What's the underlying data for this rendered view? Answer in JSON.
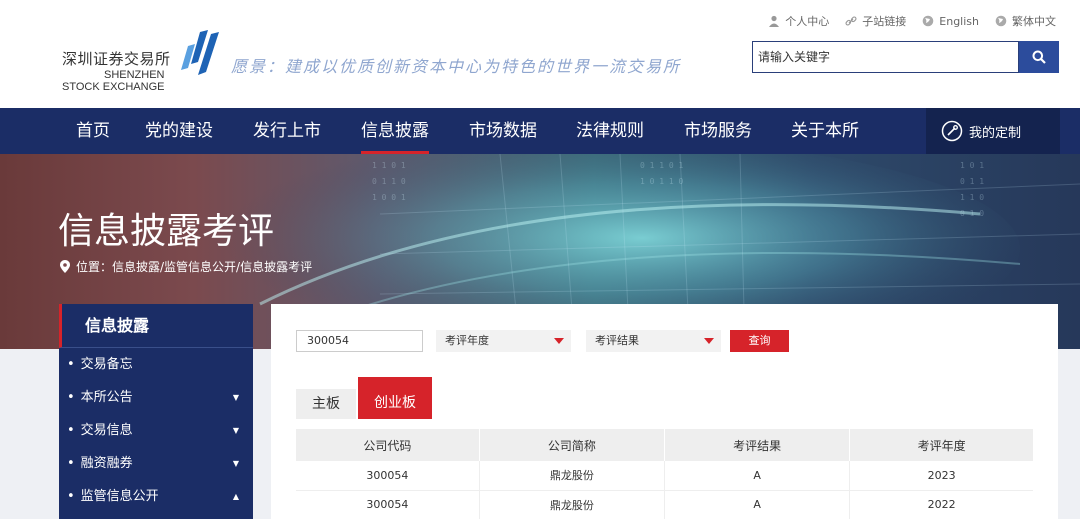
{
  "header": {
    "logo": {
      "cn": "深圳证券交易所",
      "en_line1": "SHENZHEN",
      "en_line2": "STOCK EXCHANGE"
    },
    "slogan": "愿景：建成以优质创新资本中心为特色的世界一流交易所",
    "top_links": [
      {
        "icon": "person-icon",
        "label": "个人中心"
      },
      {
        "icon": "link-icon",
        "label": "子站链接"
      },
      {
        "icon": "globe-icon",
        "label": "English"
      },
      {
        "icon": "globe-icon",
        "label": "繁体中文"
      }
    ],
    "search": {
      "placeholder": "请输入关键字"
    }
  },
  "nav": {
    "items": [
      "首页",
      "党的建设",
      "发行上市",
      "信息披露",
      "市场数据",
      "法律规则",
      "市场服务",
      "关于本所"
    ],
    "active": "信息披露",
    "custom_label": "我的定制"
  },
  "banner": {
    "title": "信息披露考评",
    "breadcrumb": "位置：信息披露/监管信息公开/信息披露考评"
  },
  "sidebar": {
    "title": "信息披露",
    "items": [
      {
        "label": "交易备忘",
        "arrow": ""
      },
      {
        "label": "本所公告",
        "arrow": "▼"
      },
      {
        "label": "交易信息",
        "arrow": "▼"
      },
      {
        "label": "融资融券",
        "arrow": "▼"
      },
      {
        "label": "监管信息公开",
        "arrow": "▲"
      }
    ]
  },
  "filters": {
    "code_value": "300054",
    "year_label": "考评年度",
    "result_label": "考评结果",
    "query_label": "查询"
  },
  "tabs": {
    "main": "主板",
    "chinext": "创业板",
    "active": "创业板"
  },
  "table": {
    "headers": [
      "公司代码",
      "公司简称",
      "考评结果",
      "考评年度"
    ],
    "rows": [
      [
        "300054",
        "鼎龙股份",
        "A",
        "2023"
      ],
      [
        "300054",
        "鼎龙股份",
        "A",
        "2022"
      ]
    ]
  },
  "colors": {
    "nav_bg": "#1b2d66",
    "accent_red": "#d6232a",
    "search_btn": "#2c4c9c"
  }
}
